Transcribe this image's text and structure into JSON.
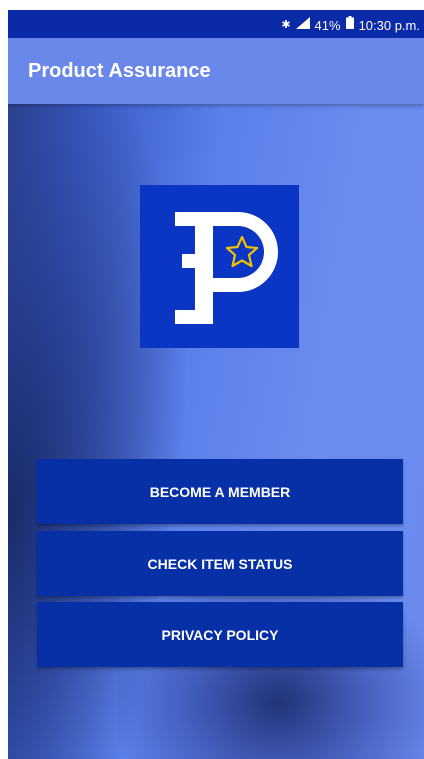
{
  "status_bar": {
    "bluetooth_icon": "bluetooth-icon",
    "signal_icon": "signal-icon",
    "battery_percent": "41%",
    "battery_icon": "battery-icon",
    "time": "10:30 p.m."
  },
  "app_bar": {
    "title": "Product Assurance"
  },
  "logo": {
    "icon": "ep-star-logo-icon"
  },
  "buttons": {
    "become_member": "BECOME A MEMBER",
    "check_status": "CHECK ITEM STATUS",
    "privacy_policy": "PRIVACY POLICY"
  },
  "colors": {
    "status_bar": "#0b2aa8",
    "app_bar": "#6a87ea",
    "button": "#0730a6",
    "logo_bg": "#0a36c3",
    "star": "#f2c200"
  }
}
